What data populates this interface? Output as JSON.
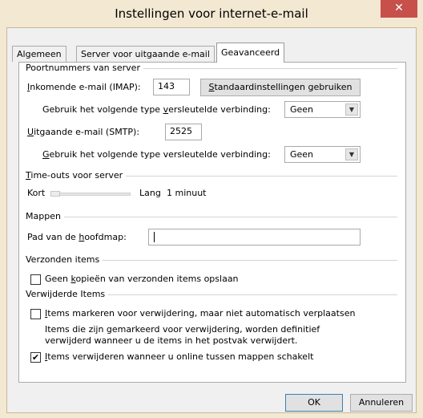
{
  "window": {
    "title": "Instellingen voor internet-e-mail",
    "close_glyph": "✕"
  },
  "tabs": [
    {
      "label": "Algemeen"
    },
    {
      "label": "Server voor uitgaande e-mail"
    },
    {
      "label": "Geavanceerd"
    }
  ],
  "ports": {
    "section_title": "Poortnummers van server",
    "imap_label_pre": "",
    "imap_label_ul": "I",
    "imap_label_post": "nkomende e-mail (IMAP):",
    "imap_value": "143",
    "defaults_button_ul": "S",
    "defaults_button_post": "tandaardinstellingen gebruiken",
    "enc_imap_pre": "Gebruik het volgende type ",
    "enc_imap_ul": "v",
    "enc_imap_post": "ersleutelde verbinding:",
    "enc_imap_value": "Geen",
    "smtp_label_ul": "U",
    "smtp_label_post": "itgaande e-mail (SMTP):",
    "smtp_value": "2525",
    "enc_smtp_ul": "G",
    "enc_smtp_post": "ebruik het volgende type versleutelde verbinding:",
    "enc_smtp_value": "Geen"
  },
  "timeouts": {
    "section_ul": "T",
    "section_post": "ime-outs voor server",
    "short_label": "Kort",
    "long_label": "Lang",
    "value": "1 minuut",
    "level": 0
  },
  "folders": {
    "section_title": "Mappen",
    "root_label_pre": "Pad van de ",
    "root_label_ul": "h",
    "root_label_post": "oofdmap:",
    "root_value": ""
  },
  "sent": {
    "section_title": "Verzonden items",
    "checkbox_pre": "Geen ",
    "checkbox_ul": "k",
    "checkbox_post": "opieën van verzonden items opslaan",
    "checked": false
  },
  "deleted": {
    "section_title": "Verwijderde Items",
    "mark_ul": "I",
    "mark_post": "tems markeren voor verwijdering, maar niet automatisch verplaatsen",
    "mark_checked": false,
    "note_line1": "Items die zijn gemarkeerd voor verwijdering, worden definitief",
    "note_line2": "verwijderd wanneer u de items in het postvak verwijdert.",
    "purge_ul": "I",
    "purge_post": "tems verwijderen wanneer u online tussen mappen schakelt",
    "purge_checked": true,
    "check_glyph": "✔"
  },
  "footer": {
    "ok_label": "OK",
    "cancel_label": "Annuleren"
  },
  "colors": {
    "title_bar": "#f3e8d2",
    "close_button": "#c7504b"
  }
}
